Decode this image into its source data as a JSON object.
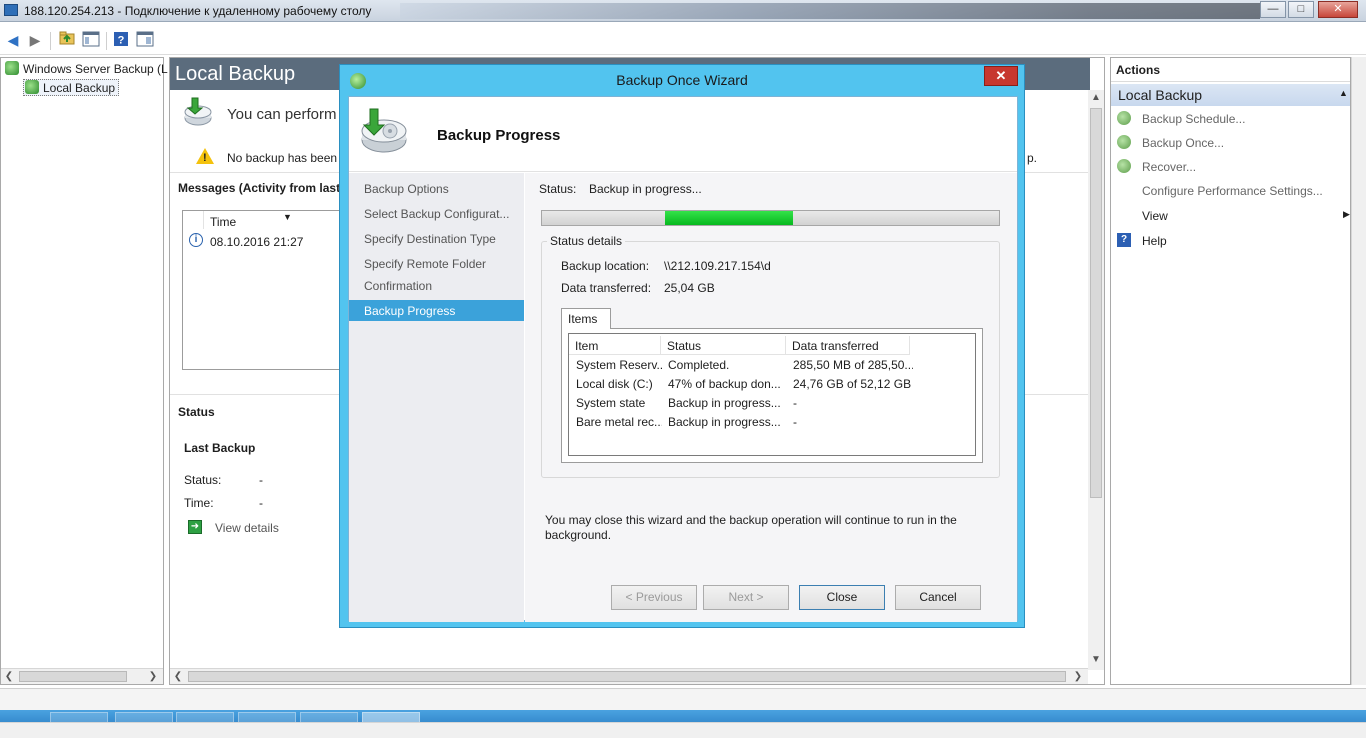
{
  "rdp": {
    "title": "188.120.254.213 - Подключение к удаленному рабочему столу",
    "min": "—",
    "max": "□",
    "close": "✕"
  },
  "tree": {
    "root": "Windows Server Backup (L",
    "child": "Local Backup"
  },
  "center": {
    "header": "Local Backup",
    "intro": "You can perform",
    "warning": "No backup has been c",
    "warning_tail": "p.",
    "messages_title": "Messages (Activity  from last",
    "messages_col_time": "Time",
    "messages_row_time": "08.10.2016 21:27",
    "status_title": "Status",
    "last_backup_title": "Last Backup",
    "status_label": "Status:",
    "status_value": "-",
    "time_label": "Time:",
    "time_value": "-",
    "view_details": "View details"
  },
  "actions": {
    "title": "Actions",
    "group": "Local Backup",
    "items": [
      "Backup Schedule...",
      "Backup Once...",
      "Recover...",
      "Configure Performance Settings...",
      "View",
      "Help"
    ]
  },
  "wizard": {
    "title": "Backup Once Wizard",
    "close": "✕",
    "heading": "Backup Progress",
    "nav": [
      "Backup Options",
      "Select Backup Configurat...",
      "Specify Destination Type",
      "Specify Remote Folder",
      "Confirmation",
      "Backup Progress"
    ],
    "status_label": "Status:",
    "status_value": "Backup in progress...",
    "progress": {
      "start_fraction": 0.27,
      "end_fraction": 0.55
    },
    "details_title": "Status details",
    "location_label": "Backup location:",
    "location_value": "\\\\212.109.217.154\\d",
    "transferred_label": "Data transferred:",
    "transferred_value": "25,04 GB",
    "items_tab": "Items",
    "columns": [
      "Item",
      "Status",
      "Data transferred"
    ],
    "rows": [
      [
        "System Reserv...",
        "Completed.",
        "285,50 MB of 285,50..."
      ],
      [
        "Local disk (C:)",
        "47% of backup don...",
        "24,76 GB of 52,12 GB"
      ],
      [
        "System state",
        "Backup in progress...",
        "-"
      ],
      [
        "Bare metal rec...",
        "Backup in progress...",
        "-"
      ]
    ],
    "note": "You may close this wizard and the backup operation will continue to run in the background.",
    "buttons": {
      "previous": "< Previous",
      "next": "Next >",
      "close": "Close",
      "cancel": "Cancel"
    }
  }
}
